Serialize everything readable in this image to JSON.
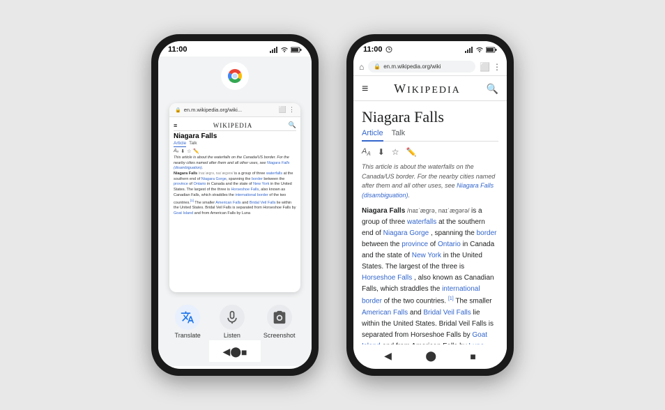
{
  "scene": {
    "background_color": "#e8e8e8"
  },
  "phone_left": {
    "status": {
      "time": "11:00",
      "signal": "▲",
      "wifi": "wifi",
      "battery": "battery"
    },
    "chrome_logo": "chrome-icon",
    "task_card": {
      "url": "en.m.wikipedia.org/wiki...",
      "site_title": "WIKIPEDIA",
      "article_title": "Niagara Falls",
      "tabs": [
        "Article",
        "Talk"
      ],
      "body_preview": "This article is about the waterfalls on the Canada/US border. For the nearby cities named after them and all other uses, see Niagara Falls (disambiguation). Niagara Falls /naɪæɡrə, naɪæɡərə/ is a group of three waterfalls at the southern end of Niagara Gorge, spanning the border between the province of Ontario in Canada and the state of New York in the United States. The largest of the three is Horseshoe Falls, also known as Canadian Falls, which straddles the international border of the two countries. The smaller American Falls and Bridal Veil Falls lie within the United States. Bridal Veil Falls is separated from Horseshoe Falls by Goat Island and from American Falls by Luna"
    },
    "bottom_actions": [
      {
        "id": "translate",
        "label": "Translate",
        "icon": "🔤"
      },
      {
        "id": "listen",
        "label": "Listen",
        "icon": "👥"
      },
      {
        "id": "screenshot",
        "label": "Screenshot",
        "icon": "📱"
      }
    ],
    "nav": {
      "back": "◀",
      "home": "⬤",
      "recents": "■"
    }
  },
  "phone_right": {
    "status": {
      "time": "11:00",
      "extra_icon": "⬡",
      "wifi": "wifi",
      "battery": "battery"
    },
    "browser": {
      "home_icon": "⌂",
      "url": "en.m.wikipedia.org/wiki",
      "tab_icon": "⬜",
      "menu_icon": "⋮"
    },
    "wikipedia": {
      "menu_icon": "≡",
      "wordmark": "Wikipedia",
      "search_icon": "🔍",
      "article_title": "Niagara Falls",
      "tabs": [
        {
          "label": "Article",
          "active": true
        },
        {
          "label": "Talk",
          "active": false
        }
      ],
      "tools": [
        "🔤",
        "⬇",
        "☆",
        "✏️"
      ],
      "notice": "This article is about the waterfalls on the Canada/US border. For the nearby cities named after them and all other uses, see Niagara Falls (disambiguation).",
      "notice_link": "Niagara Falls (disambiguation)",
      "body_parts": [
        {
          "type": "bold",
          "text": "Niagara Falls"
        },
        {
          "type": "text",
          "text": " "
        },
        {
          "type": "ipa",
          "text": "/naɪˈæɡrə, naɪˈæɡərə/"
        },
        {
          "type": "text",
          "text": " is a group of three "
        },
        {
          "type": "link",
          "text": "waterfalls"
        },
        {
          "type": "text",
          "text": " at the southern end of "
        },
        {
          "type": "link",
          "text": "Niagara Gorge"
        },
        {
          "type": "text",
          "text": ", spanning the "
        },
        {
          "type": "link",
          "text": "border"
        },
        {
          "type": "text",
          "text": " between the "
        },
        {
          "type": "link",
          "text": "province"
        },
        {
          "type": "text",
          "text": " of "
        },
        {
          "type": "link",
          "text": "Ontario"
        },
        {
          "type": "text",
          "text": " in Canada and the state of "
        },
        {
          "type": "link",
          "text": "New York"
        },
        {
          "type": "text",
          "text": " in the United States. The largest of the three is "
        },
        {
          "type": "link",
          "text": "Horseshoe Falls"
        },
        {
          "type": "text",
          "text": ", also known as Canadian Falls, which straddles the "
        },
        {
          "type": "link",
          "text": "international border"
        },
        {
          "type": "text",
          "text": " of the two countries."
        },
        {
          "type": "sup",
          "text": "[1]"
        },
        {
          "type": "text",
          "text": " The smaller "
        },
        {
          "type": "link",
          "text": "American Falls"
        },
        {
          "type": "text",
          "text": " and "
        },
        {
          "type": "link",
          "text": "Bridal Veil Falls"
        },
        {
          "type": "text",
          "text": " lie within the United States. Bridal Veil Falls is separated from Horseshoe Falls by "
        },
        {
          "type": "link",
          "text": "Goat Island"
        },
        {
          "type": "text",
          "text": " and from American Falls by "
        },
        {
          "type": "link",
          "text": "Luna"
        }
      ]
    },
    "nav": {
      "back": "◀",
      "home": "⬤",
      "recents": "■"
    }
  }
}
